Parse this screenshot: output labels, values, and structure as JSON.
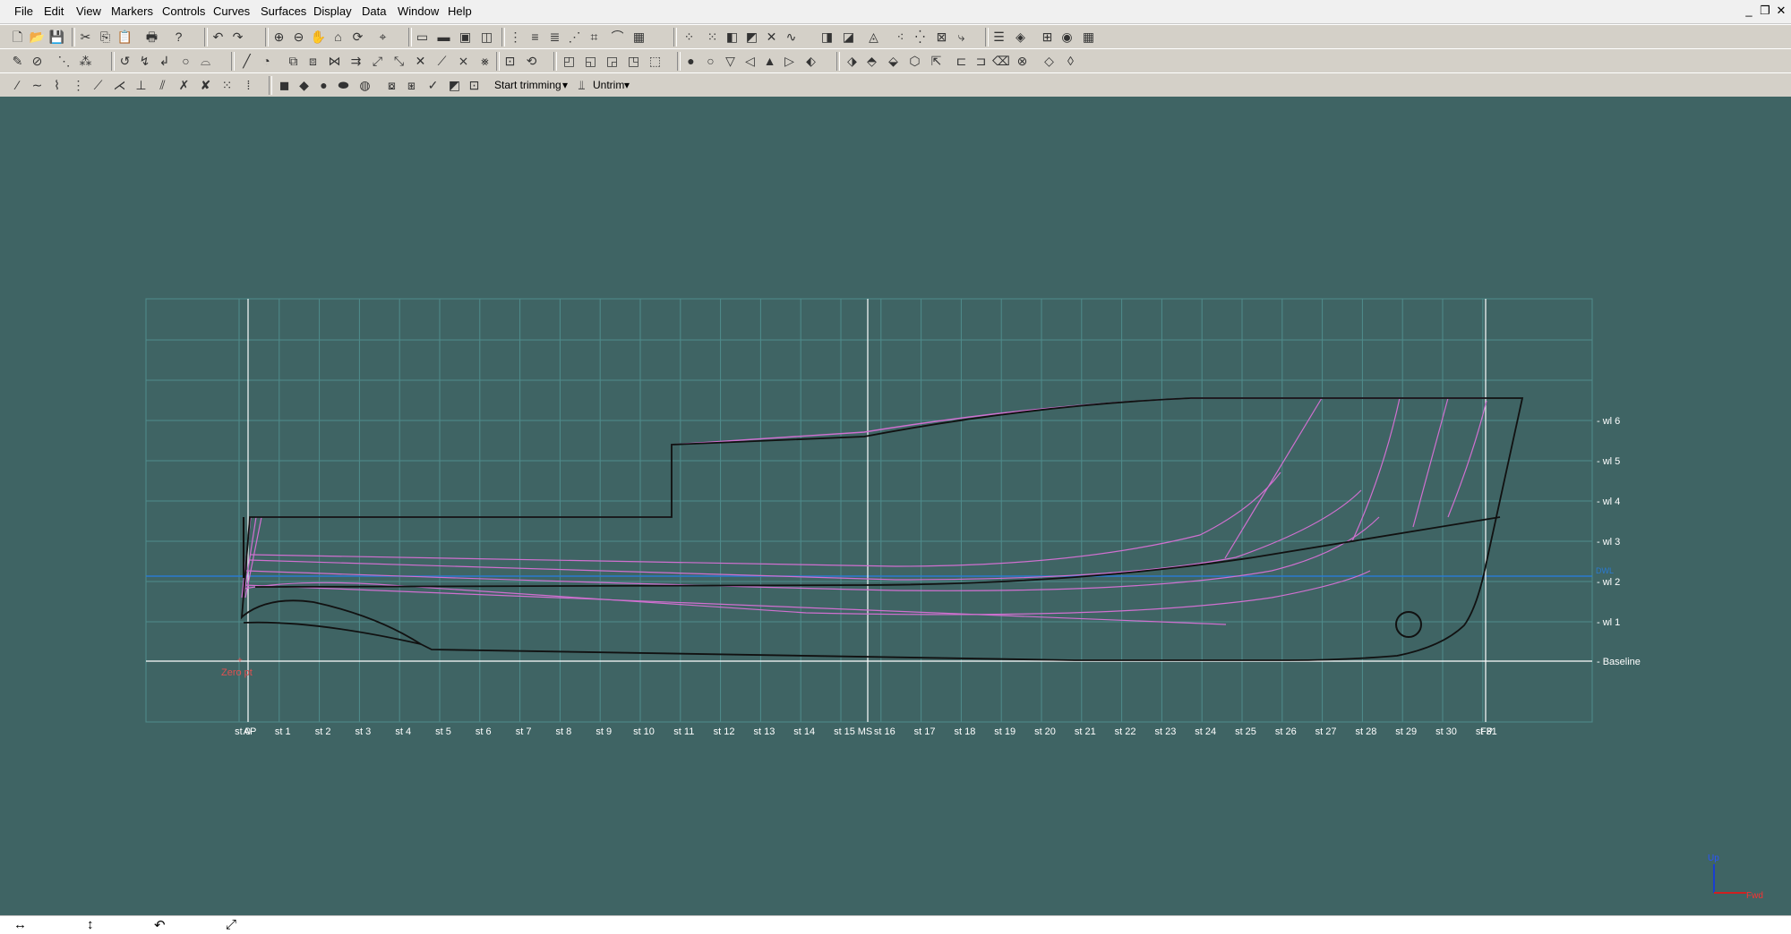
{
  "menus": [
    "File",
    "Edit",
    "View",
    "Markers",
    "Controls",
    "Curves",
    "Surfaces",
    "Display",
    "Data",
    "Window",
    "Help"
  ],
  "window_buttons": {
    "minimize": "_",
    "restore": "❐",
    "close": "✕"
  },
  "toolbar3": {
    "trim_label": "Start trimming",
    "untrim_label": "Untrim"
  },
  "drawing": {
    "waterlines": [
      "wl 6",
      "wl 5",
      "wl 4",
      "wl 3",
      "wl 2",
      "wl 1",
      "Baseline"
    ],
    "stations": [
      "st 0",
      "AP",
      "st 1",
      "st 2",
      "st 3",
      "st 4",
      "st 5",
      "st 6",
      "st 7",
      "st 8",
      "st 9",
      "st 10",
      "st 11",
      "st 12",
      "st 13",
      "st 14",
      "st 15",
      "MS",
      "st 16",
      "st 17",
      "st 18",
      "st 19",
      "st 20",
      "st 21",
      "st 22",
      "st 23",
      "st 24",
      "st 25",
      "st 26",
      "st 27",
      "st 28",
      "st 29",
      "st 30",
      "st 31",
      "FP"
    ],
    "zero_label": "Zero pt",
    "dwl_label": "DWL"
  },
  "axes": {
    "up": "Up",
    "fwd": "Fwd"
  },
  "colors": {
    "background": "#3f6464",
    "hull": "#111111",
    "curves": "#d070d0",
    "grid": "#4f8c8c",
    "dwl": "#2a7ad0",
    "zero": "#e05050"
  }
}
